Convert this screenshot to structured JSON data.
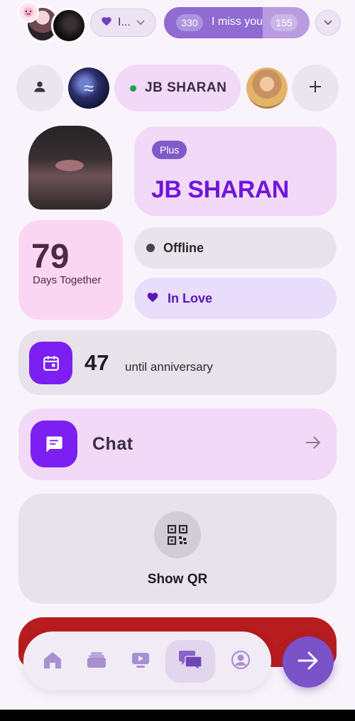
{
  "top_bar": {
    "mood_label": "I...",
    "miss_count_left": "330",
    "miss_text": "I miss you",
    "miss_count_right": "155",
    "miss_progress_fraction": 0.68
  },
  "partner_row": {
    "partner_name": "JB SHARAN"
  },
  "profile": {
    "badge": "Plus",
    "display_name": "JB SHARAN",
    "days_number": "79",
    "days_label": "Days Together",
    "status_presence": "Offline",
    "status_relationship": "In Love"
  },
  "anniversary": {
    "number": "47",
    "label": "until anniversary"
  },
  "chat": {
    "label": "Chat"
  },
  "qr": {
    "label": "Show QR"
  },
  "colors": {
    "accent": "#7b1ff2",
    "name_purple": "#6e16db",
    "online_green": "#19a548",
    "red_card": "#b71c1e"
  },
  "icons": [
    "heart-icon",
    "chevron-down-icon",
    "person-icon",
    "plus-icon",
    "calendar-icon",
    "chat-bubble-icon",
    "arrow-right-icon",
    "qr-code-icon",
    "home-icon",
    "stack-icon",
    "video-icon",
    "messages-icon",
    "profile-icon"
  ]
}
